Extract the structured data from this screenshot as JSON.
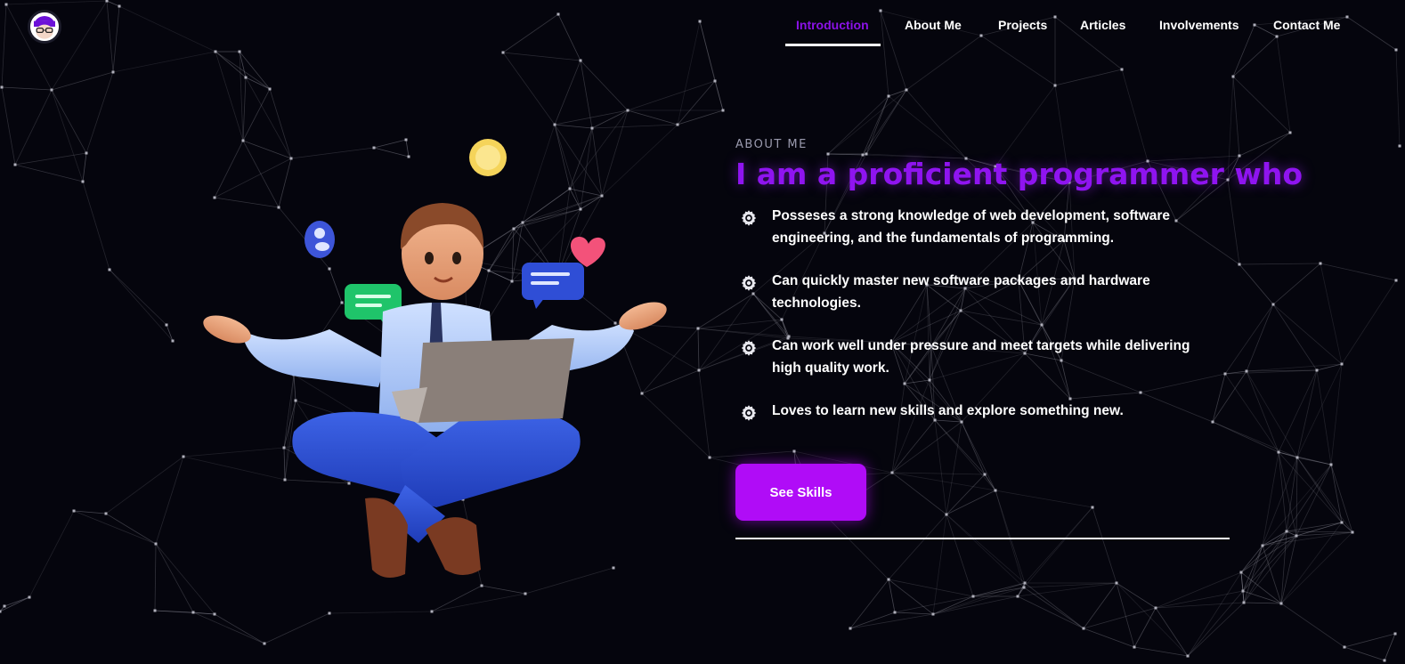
{
  "nav": {
    "items": [
      {
        "label": "Introduction",
        "active": true
      },
      {
        "label": "About Me"
      },
      {
        "label": "Projects"
      },
      {
        "label": "Articles"
      },
      {
        "label": "Involvements"
      },
      {
        "label": "Contact Me"
      }
    ]
  },
  "about": {
    "eyebrow": "ABOUT ME",
    "headline": "I am a proficient programmer who",
    "points": [
      {
        "text": "Posseses a strong knowledge of web development, software engineering, and the fundamentals of programming."
      },
      {
        "text": "Can quickly master new software packages and hardware technologies."
      },
      {
        "text": "Can work well under pressure and meet targets while delivering high quality work."
      },
      {
        "text": "Loves to learn new skills and explore something new."
      }
    ],
    "cta_label": "See Skills",
    "point_icon": "gear-icon"
  },
  "colors": {
    "background": "#05050d",
    "accent": "#8f14f0",
    "button": "#b00cf7",
    "text": "#ffffff"
  }
}
